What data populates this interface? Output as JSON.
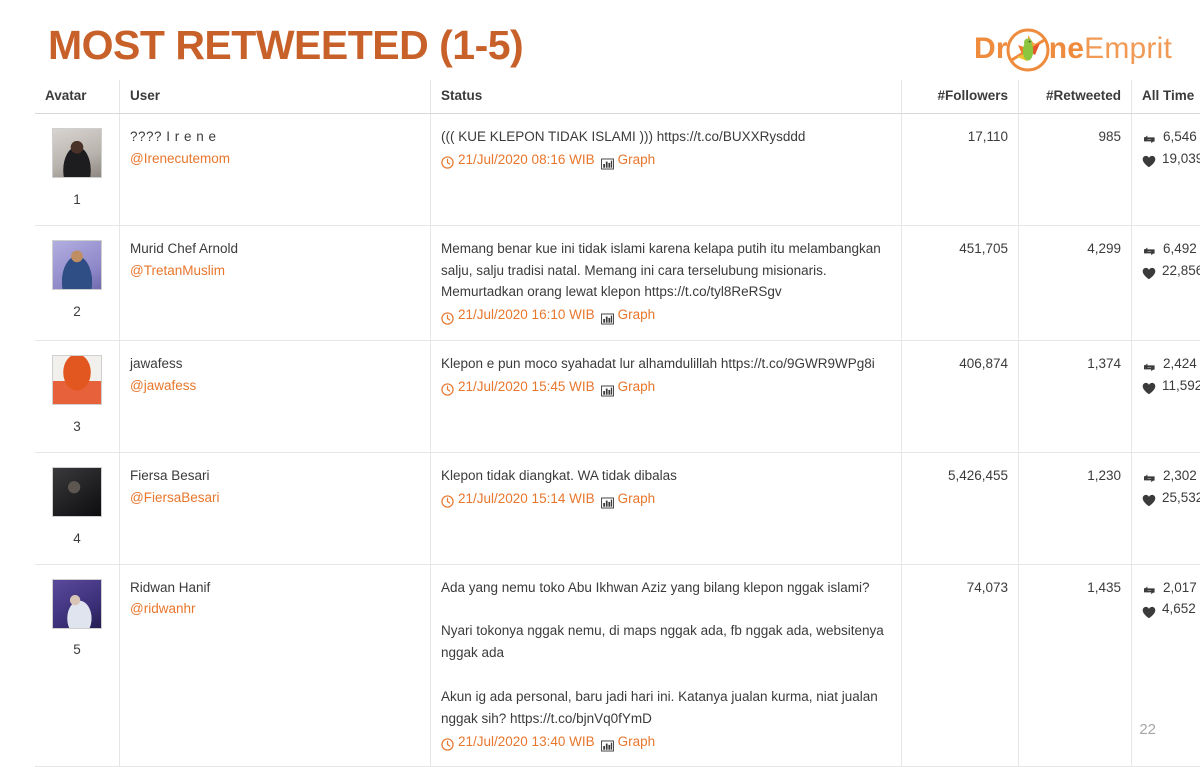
{
  "header": {
    "title": "MOST RETWEETED (1-5)",
    "brand": {
      "part1": "Dr",
      "part2": "ne",
      "part3": "Emprit",
      "mark_icon": "drone-bird-logo"
    },
    "accent_color": "#c8602a",
    "brand_color": "#ef8b3c"
  },
  "table": {
    "columns": [
      "Avatar",
      "User",
      "Status",
      "#Followers",
      "#Retweeted",
      "All Time"
    ],
    "rows": [
      {
        "rank": "1",
        "avatar_icon": "user-avatar-irene",
        "name": "???? I r e n e",
        "handle": "@Irenecutemom",
        "status": "((( KUE KLEPON TIDAK ISLAMI ))) https://t.co/BUXXRysddd",
        "timestamp": "21/Jul/2020 08:16 WIB",
        "graph_label": "Graph",
        "followers": "17,110",
        "retweeted": "985",
        "all_time_retweets": "6,546",
        "all_time_likes": "19,039"
      },
      {
        "rank": "2",
        "avatar_icon": "user-avatar-tretanmuslim",
        "name": "Murid Chef Arnold",
        "handle": "@TretanMuslim",
        "status": "Memang benar kue ini tidak islami karena kelapa putih itu melambangkan salju, salju tradisi natal. Memang ini cara terselubung misionaris. Memurtadkan orang lewat klepon https://t.co/tyl8ReRSgv",
        "timestamp": "21/Jul/2020 16:10 WIB",
        "graph_label": "Graph",
        "followers": "451,705",
        "retweeted": "4,299",
        "all_time_retweets": "6,492",
        "all_time_likes": "22,856"
      },
      {
        "rank": "3",
        "avatar_icon": "user-avatar-jawafess",
        "name": "jawafess",
        "handle": "@jawafess",
        "status": "Klepon e pun moco syahadat lur alhamdulillah https://t.co/9GWR9WPg8i",
        "timestamp": "21/Jul/2020 15:45 WIB",
        "graph_label": "Graph",
        "followers": "406,874",
        "retweeted": "1,374",
        "all_time_retweets": "2,424",
        "all_time_likes": "11,592"
      },
      {
        "rank": "4",
        "avatar_icon": "user-avatar-fiersabesari",
        "name": "Fiersa Besari",
        "handle": "@FiersaBesari",
        "status": "Klepon tidak diangkat. WA tidak dibalas",
        "timestamp": "21/Jul/2020 15:14 WIB",
        "graph_label": "Graph",
        "followers": "5,426,455",
        "retweeted": "1,230",
        "all_time_retweets": "2,302",
        "all_time_likes": "25,532"
      },
      {
        "rank": "5",
        "avatar_icon": "user-avatar-ridwanhr",
        "name": "Ridwan Hanif",
        "handle": "@ridwanhr",
        "status": "Ada yang nemu toko Abu Ikhwan Aziz yang bilang klepon nggak islami?\n\nNyari tokonya nggak nemu, di maps nggak ada, fb nggak ada, websitenya nggak ada\n\nAkun ig ada personal, baru jadi hari ini. Katanya jualan kurma, niat jualan nggak sih? https://t.co/bjnVq0fYmD",
        "timestamp": "21/Jul/2020 13:40 WIB",
        "graph_label": "Graph",
        "followers": "74,073",
        "retweeted": "1,435",
        "all_time_retweets": "2,017",
        "all_time_likes": "4,652"
      }
    ]
  },
  "footer": {
    "page_number": "22"
  }
}
